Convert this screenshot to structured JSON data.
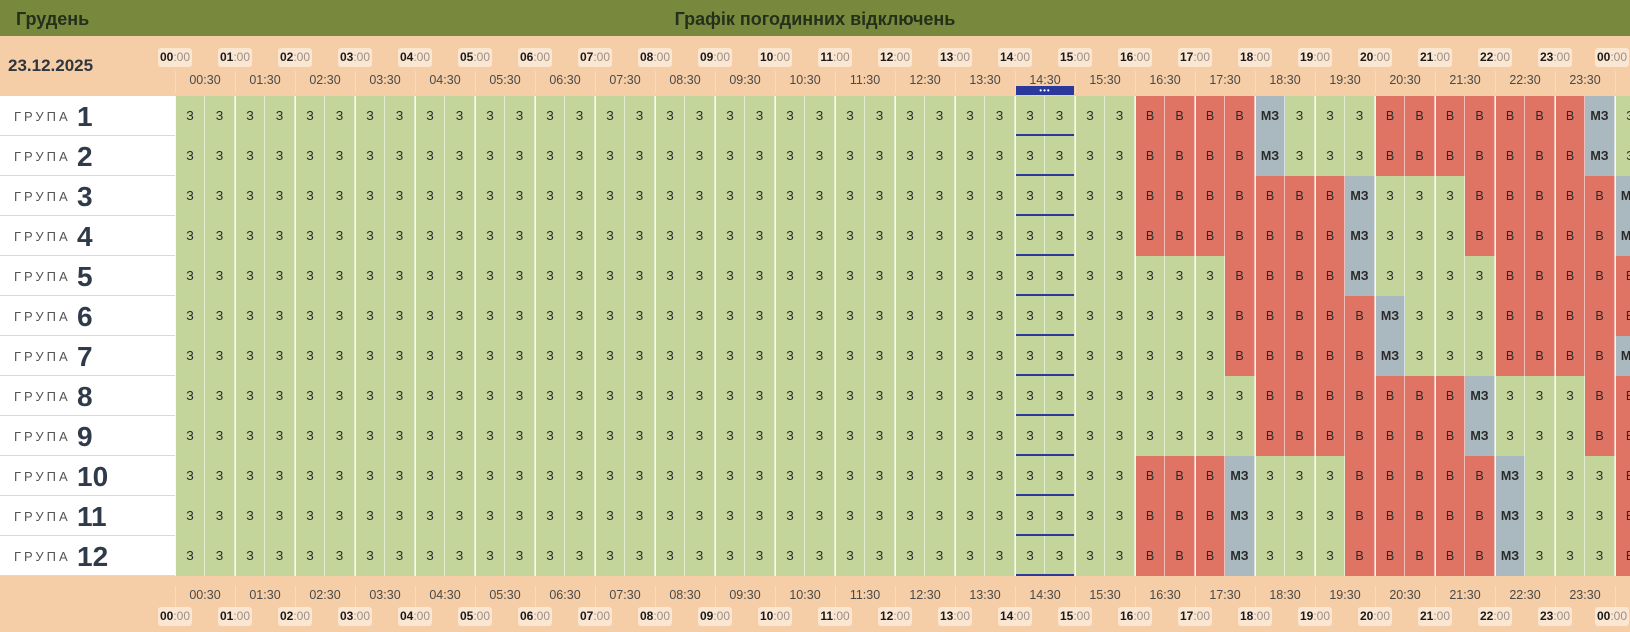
{
  "header": {
    "month": "Грудень",
    "title": "Графік погодинних відключень"
  },
  "date": "23.12.2025",
  "group_label": "ГРУПА",
  "current_indicator": "•••",
  "hours": [
    "00",
    "01",
    "02",
    "03",
    "04",
    "05",
    "06",
    "07",
    "08",
    "09",
    "10",
    "11",
    "12",
    "13",
    "14",
    "15",
    "16",
    "17",
    "18",
    "19",
    "20",
    "21",
    "22",
    "23",
    "00"
  ],
  "hour_suffix": ":00",
  "halfhours": [
    "00:30",
    "01:30",
    "02:30",
    "03:30",
    "04:30",
    "05:30",
    "06:30",
    "07:30",
    "08:30",
    "09:30",
    "10:30",
    "11:30",
    "12:30",
    "13:30",
    "14:30",
    "15:30",
    "16:30",
    "17:30",
    "18:30",
    "19:30",
    "20:30",
    "21:30",
    "22:30",
    "23:30"
  ],
  "legend_codes": {
    "on": "З",
    "off": "В",
    "maybe": "МЗ"
  },
  "colors": {
    "on": "#c4d59c",
    "off": "#df7364",
    "maybe": "#aab9c0",
    "header": "#78893e",
    "background": "#f5cda6",
    "current": "#2b3a9a"
  },
  "groups": [
    {
      "number": "1",
      "slots": "zzzzzzzzzzzzzzzzzzzzzzzzzzzzzzzzvvvvmzzzvvvvvvvmzz"
    },
    {
      "number": "2",
      "slots": "zzzzzzzzzzzzzzzzzzzzzzzzzzzzzzzzvvvvmzzzvvvvvvvmzz"
    },
    {
      "number": "3",
      "slots": "zzzzzzzzzzzzzzzzzzzzzzzzzzzzzzzzvvvvvvvmzzzvvvvvmz"
    },
    {
      "number": "4",
      "slots": "zzzzzzzzzzzzzzzzzzzzzzzzzzzzzzzzvvvvvvvmzzzvvvvvmz"
    },
    {
      "number": "5",
      "slots": "zzzzzzzzzzzzzzzzzzzzzzzzzzzzzzzzzzzvvvvmzzzzvvvvvv"
    },
    {
      "number": "6",
      "slots": "zzzzzzzzzzzzzzzzzzzzzzzzzzzzzzzzzzzvvvvvmzzzvvvvvv"
    },
    {
      "number": "7",
      "slots": "zzzzzzzzzzzzzzzzzzzzzzzzzzzzzzzzzzzvvvvvmzzzvvvvmz"
    },
    {
      "number": "8",
      "slots": "zzzzzzzzzzzzzzzzzzzzzzzzzzzzzzzzzzzzvvvvvvvmzzzvvv"
    },
    {
      "number": "9",
      "slots": "zzzzzzzzzzzzzzzzzzzzzzzzzzzzzzzzzzzzvvvvvvvmzzzvvv"
    },
    {
      "number": "10",
      "slots": "zzzzzzzzzzzzzzzzzzzzzzzzzzzzzzzzvvvmzzzvvvvvmzzzvv"
    },
    {
      "number": "11",
      "slots": "zzzzzzzzzzzzzzzzzzzzzzzzzzzzzzzzvvvmzzzvvvvvmzzzvv"
    },
    {
      "number": "12",
      "slots": "zzzzzzzzzzzzzzzzzzzzzzzzzzzzzzzzvvvmzzzvvvvvmzzzvv"
    }
  ]
}
